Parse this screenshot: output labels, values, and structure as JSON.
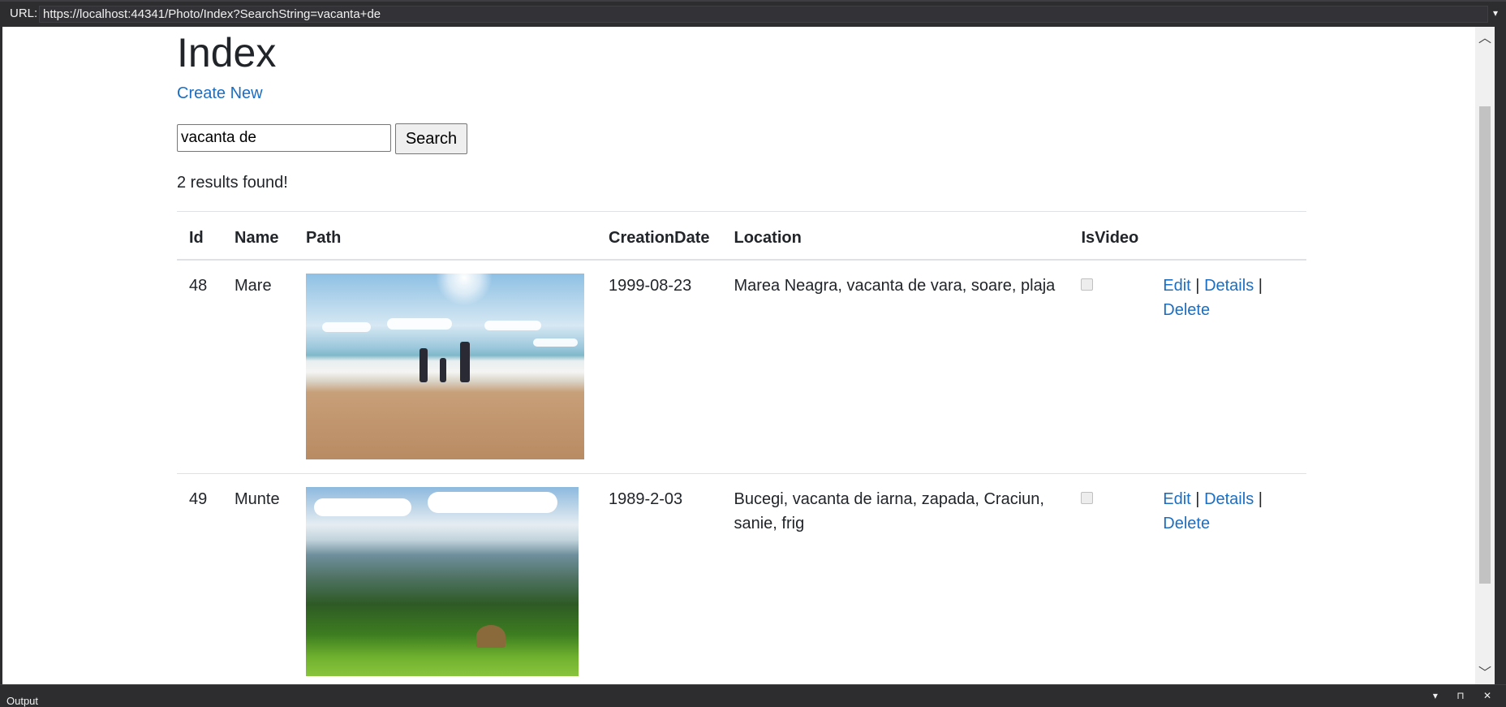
{
  "urlbar": {
    "label": "URL:",
    "url": "https://localhost:44341/Photo/Index?SearchString=vacanta+de"
  },
  "page": {
    "title": "Index",
    "create_link": "Create New",
    "search_value": "vacanta de",
    "search_button": "Search",
    "results_text": "2 results found!"
  },
  "table": {
    "headers": [
      "Id",
      "Name",
      "Path",
      "CreationDate",
      "Location",
      "IsVideo"
    ],
    "rows": [
      {
        "id": "48",
        "name": "Mare",
        "creation_date": "1999-08-23",
        "location": "Marea Neagra, vacanta de vara, soare, plaja",
        "is_video": false
      },
      {
        "id": "49",
        "name": "Munte",
        "creation_date": "1989-2-03",
        "location": "Bucegi, vacanta de iarna, zapada, Craciun, sanie, frig",
        "is_video": false
      }
    ],
    "actions": {
      "edit": "Edit",
      "details": "Details",
      "delete": "Delete",
      "separator": "|"
    }
  },
  "output": {
    "label": "Output"
  },
  "colors": {
    "link": "#1b6ec2",
    "chrome": "#2d2d30",
    "text": "#212529"
  }
}
